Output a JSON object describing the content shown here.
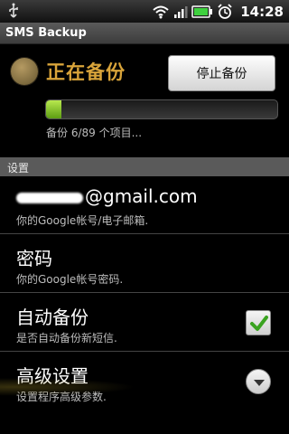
{
  "status_bar": {
    "time": "14:28"
  },
  "app": {
    "title": "SMS Backup"
  },
  "backup_status": {
    "title": "正在备份",
    "stop_button": "停止备份",
    "progress_text": "备份 6/89 个项目...",
    "progress_done": 6,
    "progress_total": 89
  },
  "settings": {
    "section_label": "设置",
    "items": [
      {
        "title_suffix": "@gmail.com",
        "summary": "你的Google帐号/电子邮箱."
      },
      {
        "title": "密码",
        "summary": "你的Google帐号密码."
      },
      {
        "title": "自动备份",
        "summary": "是否自动备份新短信.",
        "checked": true
      },
      {
        "title": "高级设置",
        "summary": "设置程序高级参数."
      }
    ]
  },
  "colors": {
    "status_title": "#d9a43a",
    "progress": "#8cc63f",
    "checkmark": "#3aa320"
  }
}
